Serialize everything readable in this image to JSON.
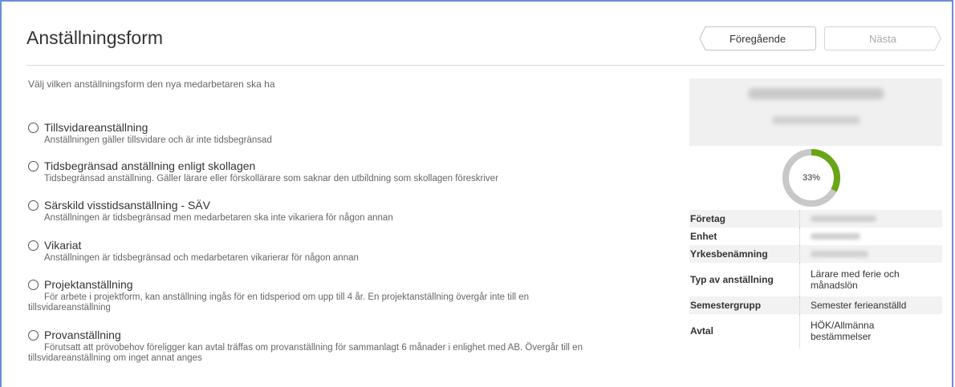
{
  "page": {
    "title": "Anställningsform",
    "prev_label": "Föregående",
    "next_label": "Nästa",
    "intro": "Välj vilken anställningsform den nya medarbetaren ska ha"
  },
  "options": [
    {
      "label": "Tillsvidareanställning",
      "desc": "Anställningen gäller tillsvidare och är inte tidsbegränsad"
    },
    {
      "label": "Tidsbegränsad anställning enligt skollagen",
      "desc": "Tidsbegränsad anställning. Gäller lärare eller förskollärare som saknar den utbildning som skollagen föreskriver"
    },
    {
      "label": "Särskild visstidsanställning - SÄV",
      "desc": "Anställningen är tidsbegränsad men medarbetaren ska inte vikariera för någon annan"
    },
    {
      "label": "Vikariat",
      "desc": "Anställningen är tidsbegränsad och medarbetaren vikarierar för någon annan"
    },
    {
      "label": "Projektanställning",
      "desc1": "För arbete i projektform, kan anställning ingås för en tidsperiod om upp till 4 år. En projektanställning övergår inte till en",
      "desc2": "tillsvidareanställning"
    },
    {
      "label": "Provanställning",
      "desc1": "Förutsatt att prövobehov föreligger kan avtal träffas om provanställning för sammanlagt 6 månader i enlighet med AB. Övergår till en",
      "desc2": "tillsvidareanställning om inget annat anges"
    }
  ],
  "progress": {
    "percent_label": "33%",
    "value": 0.33,
    "color": "#6aa516",
    "track": "#c8c8c8"
  },
  "info": [
    {
      "key": "Företag",
      "value": ""
    },
    {
      "key": "Enhet",
      "value": ""
    },
    {
      "key": "Yrkesbenämning",
      "value": ""
    },
    {
      "key": "Typ av anställning",
      "value": "Lärare med ferie och månadslön"
    },
    {
      "key": "Semestergrupp",
      "value": "Semester ferieanställd"
    },
    {
      "key": "Avtal",
      "value": "HÖK/Allmänna bestämmelser"
    }
  ]
}
